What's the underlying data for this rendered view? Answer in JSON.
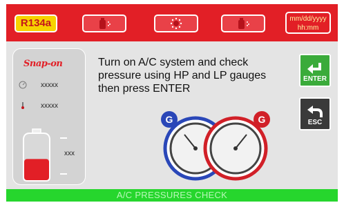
{
  "header": {
    "refrigerant": "R134a",
    "datetime_line1": "mm/dd/yyyy",
    "datetime_line2": "hh:mm",
    "buttons": [
      {
        "icon": "recover-tank-icon"
      },
      {
        "icon": "vacuum-icon"
      },
      {
        "icon": "recharge-tank-icon"
      }
    ]
  },
  "sidebar": {
    "brand": "Snap-on",
    "pressure_value": "xxxxx",
    "temperature_value": "xxxxx",
    "tank_value": "xxx",
    "tank_level_fraction": 0.45
  },
  "main": {
    "instruction": "Turn on A/C system and check pressure using HP and LP gauges then press ENTER"
  },
  "actions": {
    "enter_label": "ENTER",
    "esc_label": "ESC"
  },
  "gauges": {
    "low_marker": "G",
    "high_marker": "G"
  },
  "status": {
    "label": "A/C PRESSURES CHECK"
  },
  "colors": {
    "header_red": "#e21f26",
    "accent_yellow": "#f7d200",
    "enter_green": "#3aab3a",
    "status_green": "#26d62d",
    "tank_red": "#e21f26"
  }
}
